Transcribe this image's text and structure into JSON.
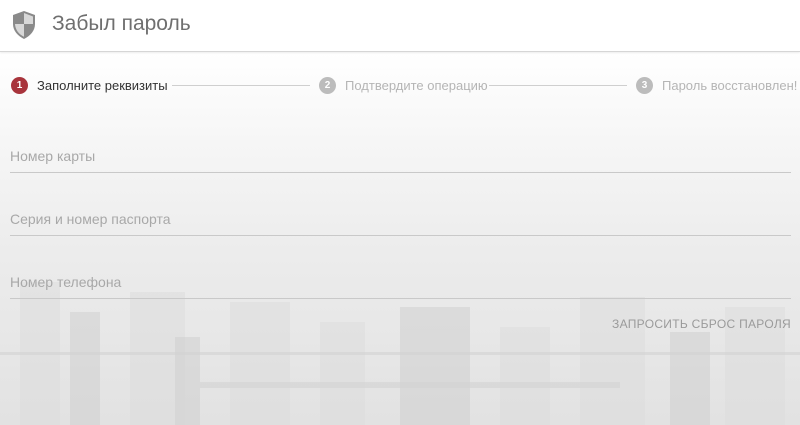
{
  "header": {
    "title": "Забыл пароль",
    "icon": "shield-icon"
  },
  "stepper": {
    "steps": [
      {
        "number": "1",
        "label": "Заполните реквизиты",
        "state": "active"
      },
      {
        "number": "2",
        "label": "Подтвердите операцию",
        "state": "inactive"
      },
      {
        "number": "3",
        "label": "Пароль восстановлен!",
        "state": "inactive"
      }
    ],
    "active_color": "#a8343c",
    "inactive_color": "#bcbcbc"
  },
  "form": {
    "card_number": {
      "placeholder": "Номер карты",
      "value": ""
    },
    "passport": {
      "placeholder": "Серия и номер паспорта",
      "value": ""
    },
    "phone": {
      "placeholder": "Номер телефона",
      "value": ""
    },
    "submit_label": "ЗАПРОСИТЬ СБРОС ПАРОЛЯ"
  }
}
